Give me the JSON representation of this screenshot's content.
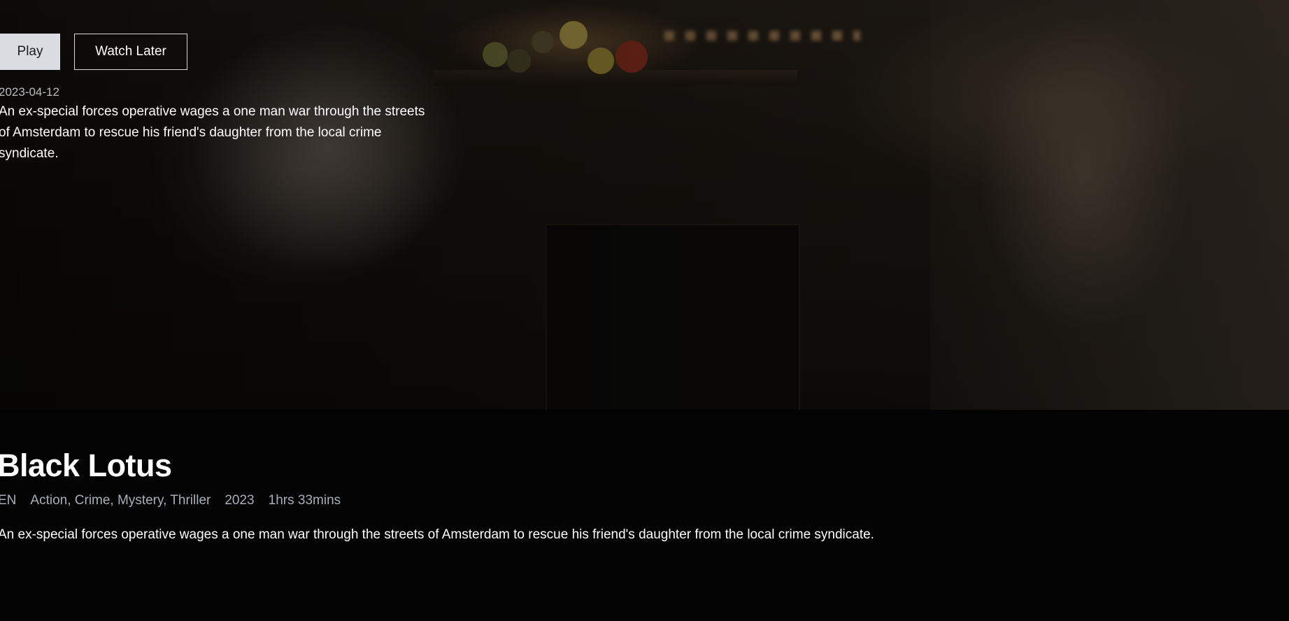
{
  "hero": {
    "play_label": "Play",
    "watch_later_label": "Watch Later",
    "release_date": "2023-04-12",
    "description": "An ex-special forces operative wages a one man war through the streets of Amsterdam to rescue his friend's daughter from the local crime syndicate."
  },
  "details": {
    "title": "Black Lotus",
    "language": "EN",
    "genres": "Action, Crime, Mystery, Thriller",
    "year": "2023",
    "runtime": "1hrs 33mins",
    "description": "An ex-special forces operative wages a one man war through the streets of Amsterdam to rescue his friend's daughter from the local crime syndicate."
  },
  "colors": {
    "background": "#030303",
    "play_button_bg": "#d9dde2",
    "meta_text": "#a9afb8"
  }
}
